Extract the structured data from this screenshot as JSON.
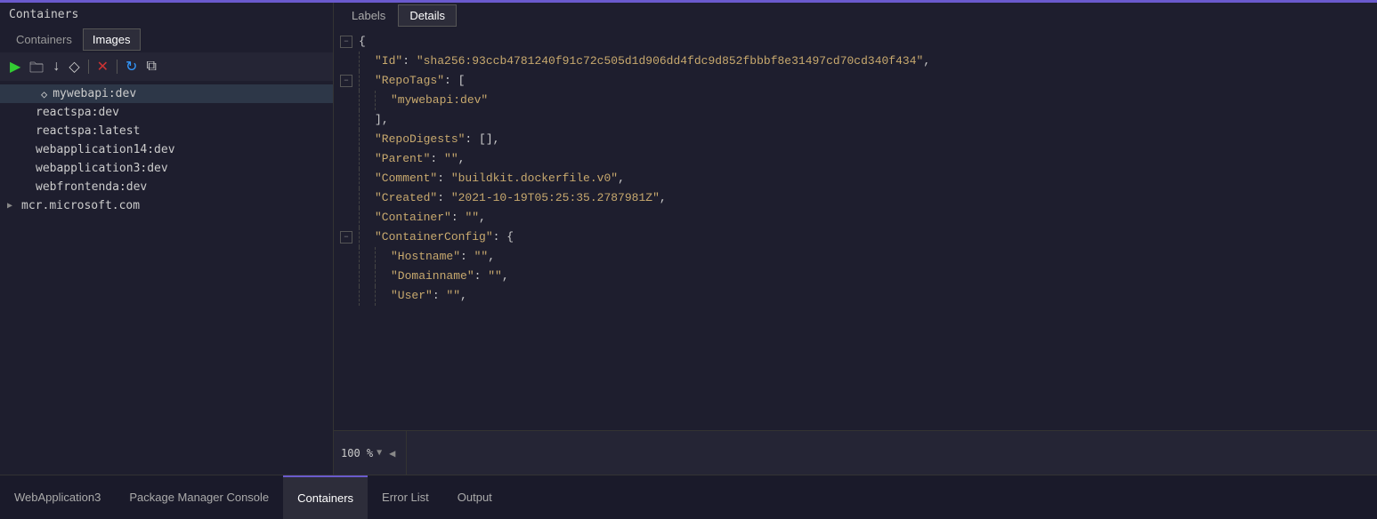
{
  "window": {
    "title": "Containers"
  },
  "left_panel": {
    "title": "Containers",
    "tabs": [
      {
        "label": "Containers",
        "active": false
      },
      {
        "label": "Images",
        "active": true
      }
    ],
    "toolbar": {
      "play_label": "▶",
      "folder_label": "📁",
      "download_label": "↓",
      "tag_label": "◇",
      "delete_label": "✕",
      "refresh_label": "↻",
      "copy_label": "⧉"
    },
    "images": [
      {
        "id": "mywebapi",
        "label": "mywebapi:dev",
        "selected": true,
        "icon": "◇",
        "level": 1
      },
      {
        "id": "reactspa1",
        "label": "reactspa:dev",
        "selected": false,
        "icon": null,
        "level": 1
      },
      {
        "id": "reactspa2",
        "label": "reactspa:latest",
        "selected": false,
        "icon": null,
        "level": 1
      },
      {
        "id": "webapp14",
        "label": "webapplication14:dev",
        "selected": false,
        "icon": null,
        "level": 1
      },
      {
        "id": "webapp3",
        "label": "webapplication3:dev",
        "selected": false,
        "icon": null,
        "level": 1
      },
      {
        "id": "webfrontenda",
        "label": "webfrontenda:dev",
        "selected": false,
        "icon": null,
        "level": 1
      },
      {
        "id": "mcr",
        "label": "mcr.microsoft.com",
        "selected": false,
        "icon": null,
        "level": 0,
        "expandable": true
      }
    ]
  },
  "right_panel": {
    "tabs": [
      {
        "label": "Labels",
        "active": false
      },
      {
        "label": "Details",
        "active": true
      }
    ],
    "json_lines": [
      {
        "id": 1,
        "collapse": true,
        "indent": 0,
        "content": "{"
      },
      {
        "id": 2,
        "collapse": false,
        "indent": 1,
        "content": "\"Id\": \"sha256:93ccb4781240f91c72c505d1d906dd4fdc9d852fbbbf8e31497cd70cd340f434\","
      },
      {
        "id": 3,
        "collapse": true,
        "indent": 1,
        "content": "\"RepoTags\": ["
      },
      {
        "id": 4,
        "collapse": false,
        "indent": 2,
        "content": "\"mywebapi:dev\""
      },
      {
        "id": 5,
        "collapse": false,
        "indent": 1,
        "content": "],"
      },
      {
        "id": 6,
        "collapse": false,
        "indent": 1,
        "content": "\"RepoDigests\": [],"
      },
      {
        "id": 7,
        "collapse": false,
        "indent": 1,
        "content": "\"Parent\": \"\","
      },
      {
        "id": 8,
        "collapse": false,
        "indent": 1,
        "content": "\"Comment\": \"buildkit.dockerfile.v0\","
      },
      {
        "id": 9,
        "collapse": false,
        "indent": 1,
        "content": "\"Created\": \"2021-10-19T05:25:35.2787981Z\","
      },
      {
        "id": 10,
        "collapse": false,
        "indent": 1,
        "content": "\"Container\": \"\","
      },
      {
        "id": 11,
        "collapse": true,
        "indent": 1,
        "content": "\"ContainerConfig\": {"
      },
      {
        "id": 12,
        "collapse": false,
        "indent": 2,
        "content": "\"Hostname\": \"\","
      },
      {
        "id": 13,
        "collapse": false,
        "indent": 2,
        "content": "\"Domainname\": \"\","
      },
      {
        "id": 14,
        "collapse": false,
        "indent": 2,
        "content": "\"User\": \"\","
      }
    ],
    "zoom": "100 %"
  },
  "bottom_tabs": [
    {
      "label": "WebApplication3",
      "active": false
    },
    {
      "label": "Package Manager Console",
      "active": false
    },
    {
      "label": "Containers",
      "active": true
    },
    {
      "label": "Error List",
      "active": false
    },
    {
      "label": "Output",
      "active": false
    }
  ],
  "colors": {
    "accent": "#6a5acd",
    "json_key": "#c8a96e",
    "json_string": "#c8a96e",
    "background": "#1e1e2e",
    "panel": "#252535"
  }
}
